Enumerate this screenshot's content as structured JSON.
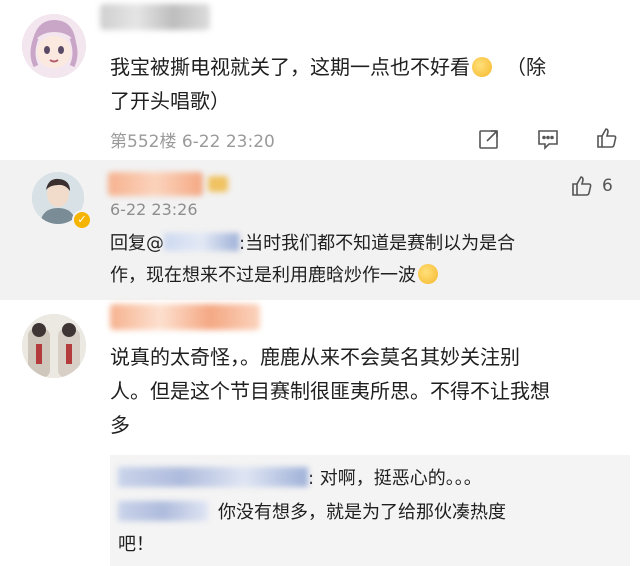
{
  "comments": [
    {
      "text_line1": "我宝被撕电视就关了，这期一点也不好看",
      "emoji": "shushing-face-emoji",
      "text_line1_tail": "（除",
      "text_line2": "了开头唱歌）",
      "meta": "第552楼 6-22 23:20"
    },
    {
      "reply_meta": "6-22 23:26",
      "like_count": "6",
      "reply_prefix": "回复@",
      "reply_line1": ":当时我们都不知道是赛制以为是合",
      "reply_line2": "作，现在想来不过是利用鹿晗炒作一波",
      "emoji": "tears-of-joy-emoji"
    },
    {
      "text_line1": "说真的太奇怪，。鹿鹿从来不会莫名其妙关注别",
      "text_line2": "人。但是这个节目赛制很匪夷所思。不得不让我想",
      "text_line3": "多",
      "subreplies": [
        {
          "text": ": 对啊，挺恶心的。。。"
        },
        {
          "text_line1": "你没有想多，就是为了给那伙凑热度",
          "text_line2": "吧！"
        }
      ]
    }
  ],
  "colors": {
    "reply_bg": "#f2f2f2",
    "sub_bg": "#f4f4f4",
    "meta": "#9a9a9a"
  }
}
